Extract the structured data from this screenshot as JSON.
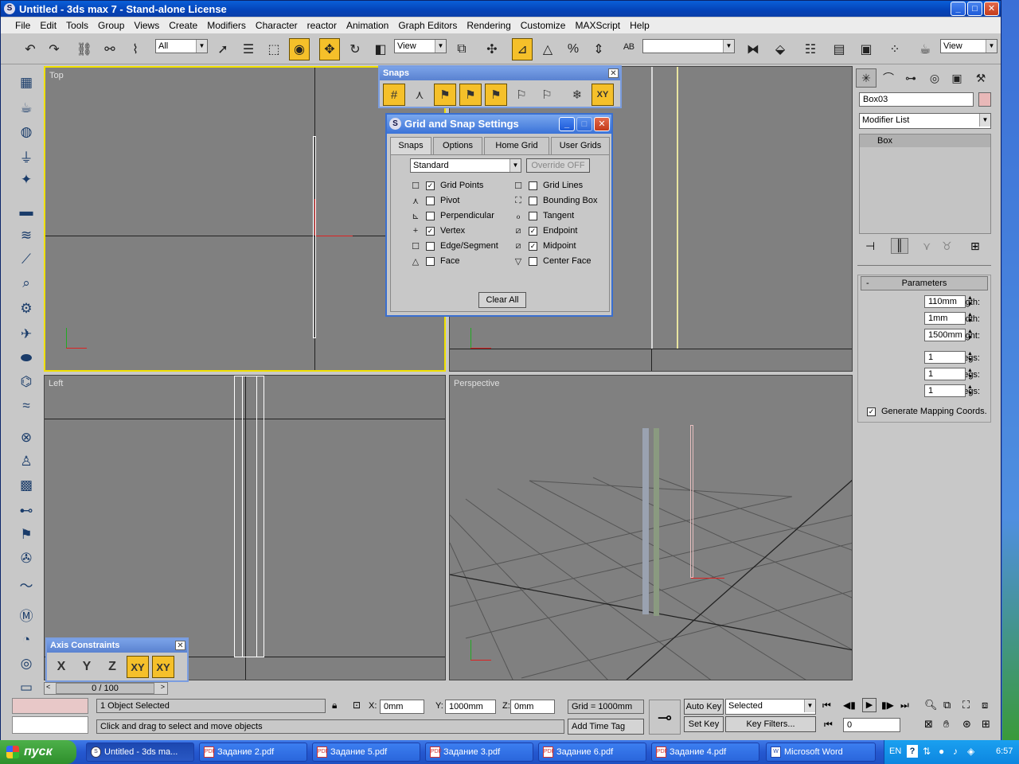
{
  "window": {
    "title": "Untitled - 3ds max 7  - Stand-alone License"
  },
  "menu": [
    "File",
    "Edit",
    "Tools",
    "Group",
    "Views",
    "Create",
    "Modifiers",
    "Character",
    "reactor",
    "Animation",
    "Graph Editors",
    "Rendering",
    "Customize",
    "MAXScript",
    "Help"
  ],
  "toolbar": {
    "selection_filter": "All",
    "ref_coord_system": "View",
    "named_selection": "",
    "render_view": "View"
  },
  "viewports": {
    "top": "Top",
    "front": "",
    "left": "Left",
    "perspective": "Perspective"
  },
  "snaps_toolbar": {
    "title": "Snaps",
    "xy_label": "XY"
  },
  "grid_snap_dialog": {
    "title": "Grid and Snap Settings",
    "tabs": [
      "Snaps",
      "Options",
      "Home Grid",
      "User Grids"
    ],
    "category": "Standard",
    "override_label": "Override OFF",
    "left_snaps": [
      {
        "label": "Grid Points",
        "checked": true
      },
      {
        "label": "Pivot",
        "checked": false
      },
      {
        "label": "Perpendicular",
        "checked": false
      },
      {
        "label": "Vertex",
        "checked": true
      },
      {
        "label": "Edge/Segment",
        "checked": false
      },
      {
        "label": "Face",
        "checked": false
      }
    ],
    "right_snaps": [
      {
        "label": "Grid Lines",
        "checked": false
      },
      {
        "label": "Bounding Box",
        "checked": false
      },
      {
        "label": "Tangent",
        "checked": false
      },
      {
        "label": "Endpoint",
        "checked": true
      },
      {
        "label": "Midpoint",
        "checked": true
      },
      {
        "label": "Center Face",
        "checked": false
      }
    ],
    "clear_all_label": "Clear All"
  },
  "axis_constraints": {
    "title": "Axis Constraints",
    "x": "X",
    "y": "Y",
    "z": "Z",
    "xy": "XY"
  },
  "command_panel": {
    "object_name": "Box03",
    "modifier_list": "Modifier List",
    "stack_item": "Box",
    "rollout_title": "Parameters",
    "params": [
      {
        "label": "Length:",
        "value": "110mm"
      },
      {
        "label": "Width:",
        "value": "1mm"
      },
      {
        "label": "Height:",
        "value": "1500mm"
      },
      {
        "label": "Length Segs:",
        "value": "1"
      },
      {
        "label": "Width Segs:",
        "value": "1"
      },
      {
        "label": "Height Segs:",
        "value": "1"
      }
    ],
    "mapping_label": "Generate Mapping Coords."
  },
  "timeline": {
    "frame": "0 / 100"
  },
  "status": {
    "selected_count": "1 Object Selected",
    "prompt": "Click and drag to select and move objects",
    "x_label": "X:",
    "x_value": "0mm",
    "y_label": "Y:",
    "y_value": "1000mm",
    "z_label": "Z:",
    "z_value": "0mm",
    "grid": "Grid = 1000mm",
    "add_time_tag": "Add Time Tag",
    "auto_key": "Auto Key",
    "set_key": "Set Key",
    "key_mode": "Selected",
    "key_filters": "Key Filters...",
    "current_frame": "0"
  },
  "taskbar": {
    "start": "пуск",
    "tasks": [
      "Untitled - 3ds ma...",
      "Задание 2.pdf",
      "Задание 5.pdf",
      "Задание 3.pdf",
      "Задание 6.pdf",
      "Задание 4.pdf",
      "Microsoft Word"
    ],
    "lang": "EN",
    "clock": "6:57"
  },
  "colors": {
    "active_toggle": "#f5c02a",
    "viewport_bg": "#808080",
    "active_viewport_border": "#f0e000",
    "title_blue": "#0a5fd8"
  }
}
